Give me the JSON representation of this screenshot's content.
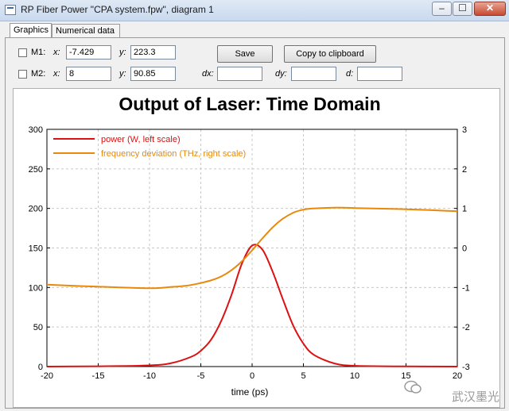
{
  "window": {
    "title": "RP Fiber Power \"CPA system.fpw\", diagram 1",
    "min_glyph": "–",
    "max_glyph": "☐",
    "close_glyph": "✕"
  },
  "tabs": [
    {
      "label": "Graphics",
      "active": true
    },
    {
      "label": "Numerical data",
      "active": false
    }
  ],
  "markers": {
    "m1": {
      "label": "M1:",
      "x_label": "x:",
      "x_value": "-7.429",
      "y_label": "y:",
      "y_value": "223.3"
    },
    "m2": {
      "label": "M2:",
      "x_label": "x:",
      "x_value": "8",
      "y_label": "y:",
      "y_value": "90.85"
    },
    "dx_label": "dx:",
    "dy_label": "dy:",
    "d_label": "d:",
    "dx_value": "",
    "dy_value": "",
    "d_value": ""
  },
  "buttons": {
    "save": "Save",
    "copy": "Copy to clipboard"
  },
  "chart_data": {
    "type": "line",
    "title": "Output of Laser: Time Domain",
    "xlabel": "time (ps)",
    "xlim": [
      -20,
      20
    ],
    "ylim_left": [
      0,
      300
    ],
    "ylim_right": [
      -3,
      3
    ],
    "xticks": [
      "-20",
      "-15",
      "-10",
      "-5",
      "0",
      "5",
      "10",
      "15",
      "20"
    ],
    "yticks_left": [
      "0",
      "50",
      "100",
      "150",
      "200",
      "250",
      "300"
    ],
    "yticks_right": [
      "-3",
      "-2",
      "-1",
      "0",
      "1",
      "2",
      "3"
    ],
    "grid": true,
    "legend_position": "top-left",
    "series": [
      {
        "name": "power (W, left scale)",
        "color": "#dd1111",
        "axis": "left",
        "x": [
          -20,
          -14,
          -10,
          -8,
          -6,
          -5,
          -4,
          -3,
          -2,
          -1,
          0,
          1,
          2,
          3,
          4,
          5,
          6,
          8,
          10,
          14,
          20
        ],
        "y": [
          0,
          0.5,
          1.5,
          4,
          12,
          20,
          34,
          58,
          91,
          130,
          153,
          148,
          120,
          85,
          52,
          29,
          15,
          4,
          1,
          0.3,
          0
        ]
      },
      {
        "name": "frequency deviation (THz, right scale)",
        "color": "#e8890c",
        "axis": "right",
        "x": [
          -20,
          -15,
          -10,
          -8,
          -6,
          -4,
          -3,
          -2,
          -1,
          0,
          1,
          2,
          3,
          4,
          5,
          6,
          8,
          10,
          15,
          20
        ],
        "y": [
          -0.93,
          -0.98,
          -1.02,
          -0.99,
          -0.94,
          -0.82,
          -0.72,
          -0.56,
          -0.34,
          -0.06,
          0.24,
          0.52,
          0.74,
          0.89,
          0.97,
          1.0,
          1.02,
          1.01,
          0.98,
          0.93
        ]
      }
    ]
  },
  "watermark": {
    "text": "武汉墨光"
  }
}
